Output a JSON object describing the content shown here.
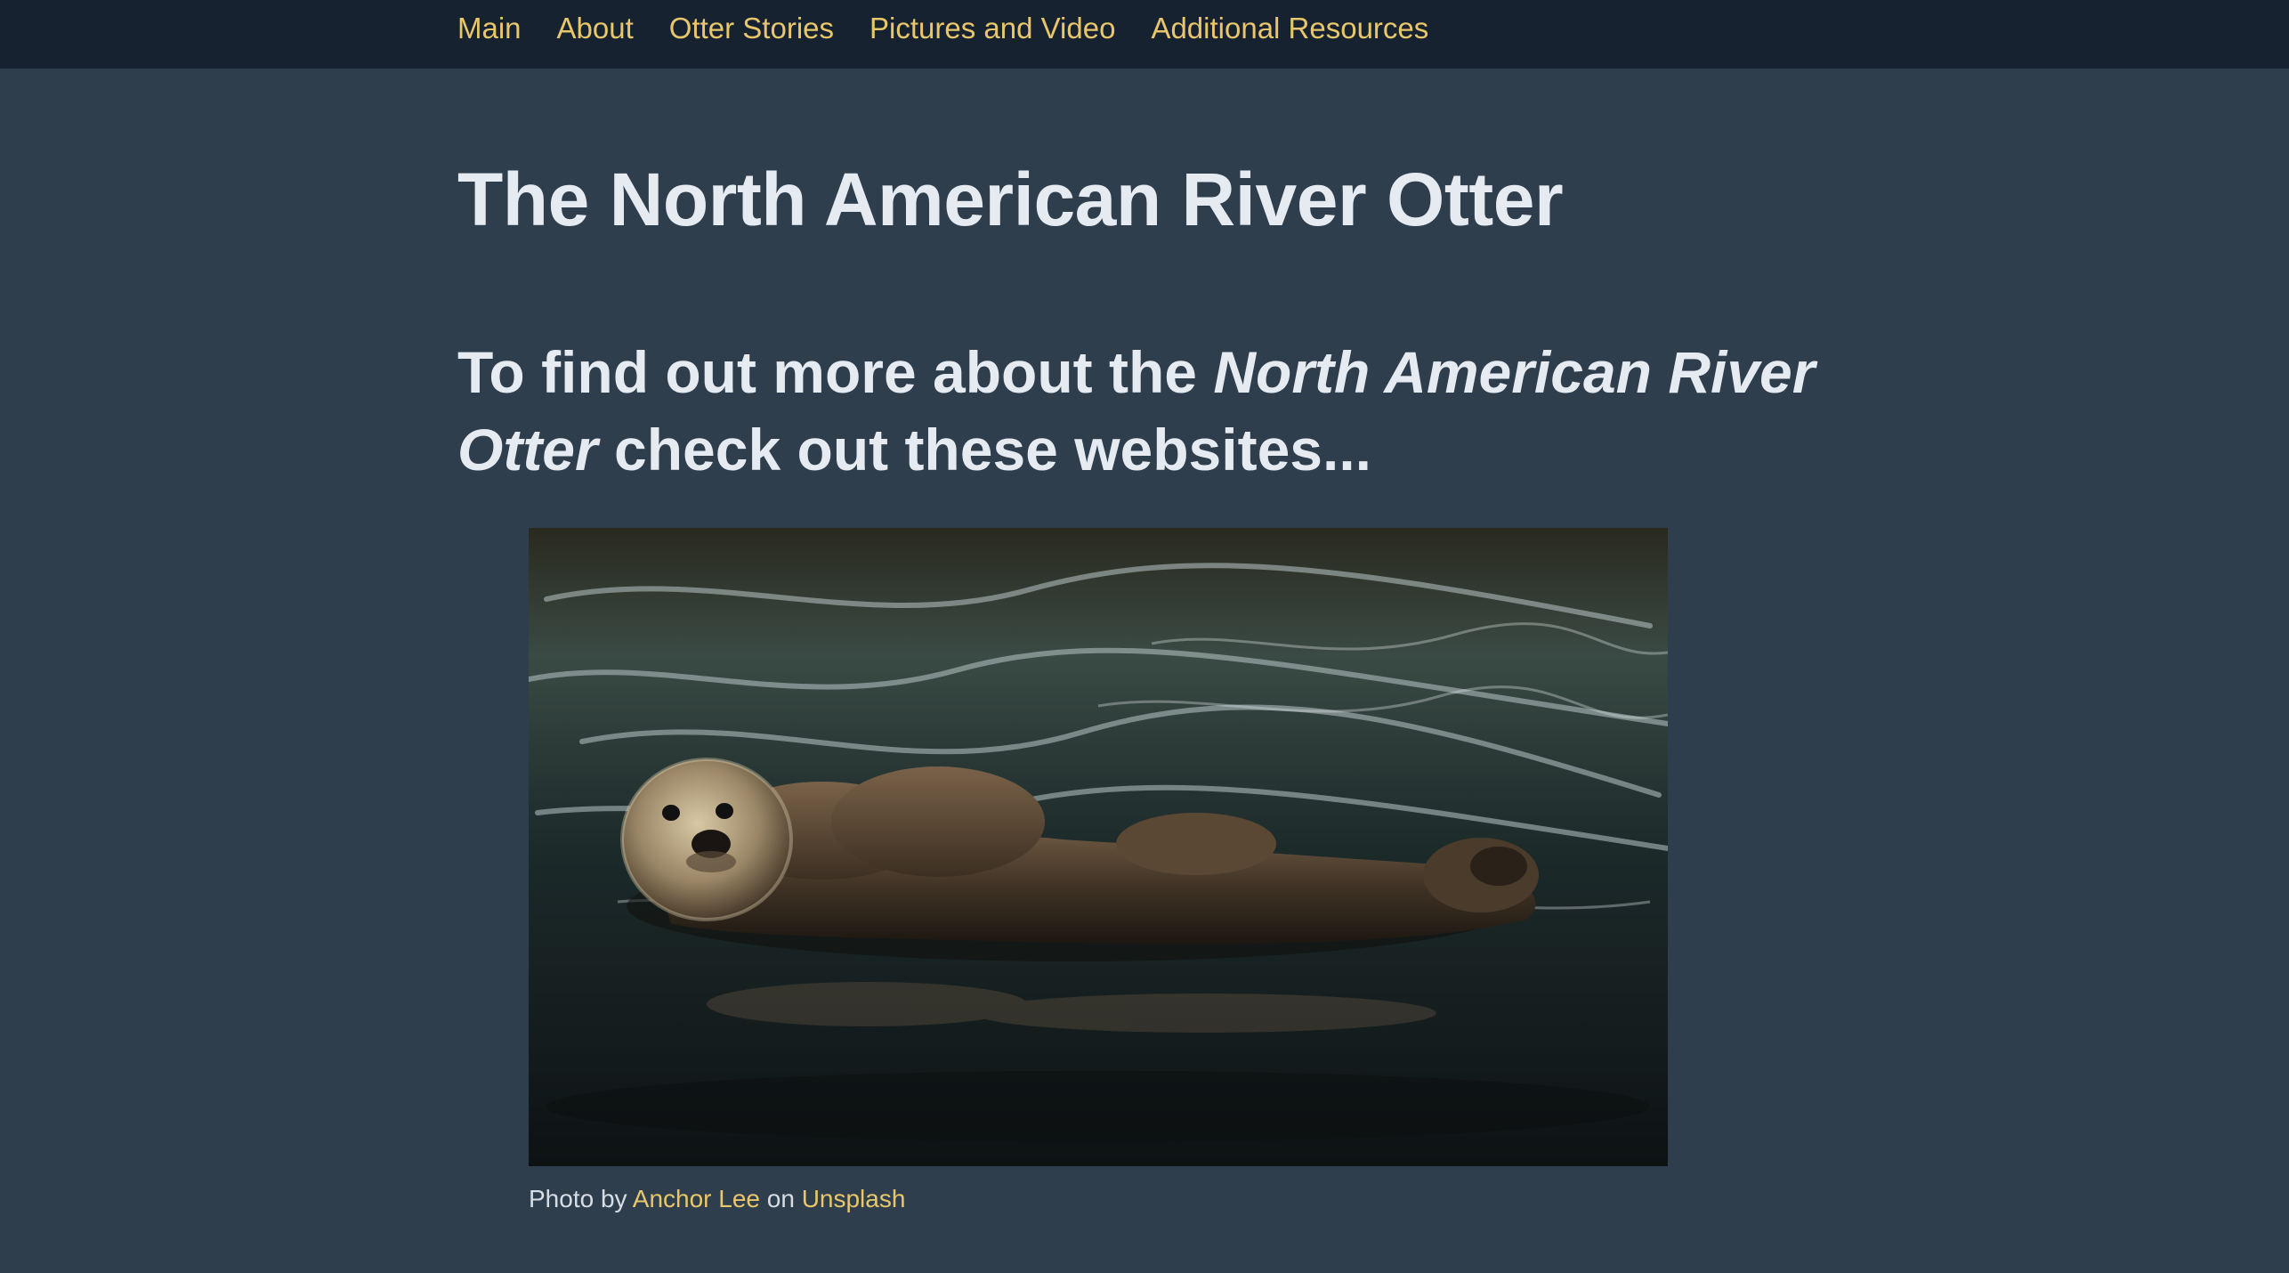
{
  "nav": {
    "items": [
      {
        "label": "Main"
      },
      {
        "label": "About"
      },
      {
        "label": "Otter Stories"
      },
      {
        "label": "Pictures and Video"
      },
      {
        "label": "Additional Resources"
      }
    ]
  },
  "page": {
    "title": "The North American River Otter",
    "subheading_prefix": "To find out more about the ",
    "subheading_emphasis": "North American River Otter",
    "subheading_suffix": " check out these websites..."
  },
  "photo": {
    "alt": "Sea otter floating on its back in dark water",
    "caption_prefix": "Photo by ",
    "author_link": "Anchor Lee",
    "caption_middle": " on ",
    "source_link": "Unsplash"
  },
  "colors": {
    "background": "#2f3e4d",
    "nav_background": "#172230",
    "link": "#e8c66b",
    "heading": "#e6ebf2"
  }
}
